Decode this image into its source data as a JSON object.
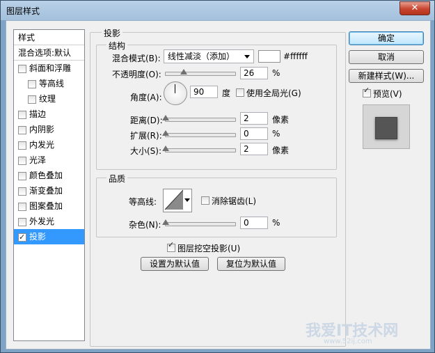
{
  "window": {
    "title": "图层样式",
    "close_glyph": "✕"
  },
  "list": {
    "items": [
      {
        "label": "样式",
        "kind": "header"
      },
      {
        "label": "混合选项:默认",
        "kind": "header"
      },
      {
        "label": "斜面和浮雕",
        "kind": "item",
        "checked": false
      },
      {
        "label": "等高线",
        "kind": "sub",
        "checked": false
      },
      {
        "label": "纹理",
        "kind": "sub",
        "checked": false
      },
      {
        "label": "描边",
        "kind": "item",
        "checked": false
      },
      {
        "label": "内阴影",
        "kind": "item",
        "checked": false
      },
      {
        "label": "内发光",
        "kind": "item",
        "checked": false
      },
      {
        "label": "光泽",
        "kind": "item",
        "checked": false
      },
      {
        "label": "颜色叠加",
        "kind": "item",
        "checked": false
      },
      {
        "label": "渐变叠加",
        "kind": "item",
        "checked": false
      },
      {
        "label": "图案叠加",
        "kind": "item",
        "checked": false
      },
      {
        "label": "外发光",
        "kind": "item",
        "checked": false
      },
      {
        "label": "投影",
        "kind": "item",
        "checked": true,
        "selected": true
      }
    ]
  },
  "panel": {
    "section_title": "投影",
    "structure": {
      "title": "结构",
      "blend_mode_label": "混合模式(B):",
      "blend_mode_value": "线性减淡（添加）",
      "color_hex": "#ffffff",
      "opacity_label": "不透明度(O):",
      "opacity_value": "26",
      "opacity_unit": "%",
      "opacity_fraction": 0.26,
      "angle_label": "角度(A):",
      "angle_value": "90",
      "angle_unit": "度",
      "global_light_label": "使用全局光(G)",
      "global_light_checked": false,
      "distance_label": "距离(D):",
      "distance_value": "2",
      "distance_unit": "像素",
      "spread_label": "扩展(R):",
      "spread_value": "0",
      "spread_unit": "%",
      "size_label": "大小(S):",
      "size_value": "2",
      "size_unit": "像素"
    },
    "quality": {
      "title": "品质",
      "contour_label": "等高线:",
      "antialias_label": "消除锯齿(L)",
      "antialias_checked": false,
      "noise_label": "杂色(N):",
      "noise_value": "0",
      "noise_unit": "%"
    },
    "knockout_label": "图层挖空投影(U)",
    "knockout_checked": true,
    "make_default_label": "设置为默认值",
    "reset_default_label": "复位为默认值"
  },
  "buttons": {
    "ok": "确定",
    "cancel": "取消",
    "new_style": "新建样式(W)...",
    "preview_label": "预览(V)",
    "preview_checked": true
  },
  "watermark": {
    "main": "我爱IT技术网",
    "url": "www.52ij.com"
  }
}
